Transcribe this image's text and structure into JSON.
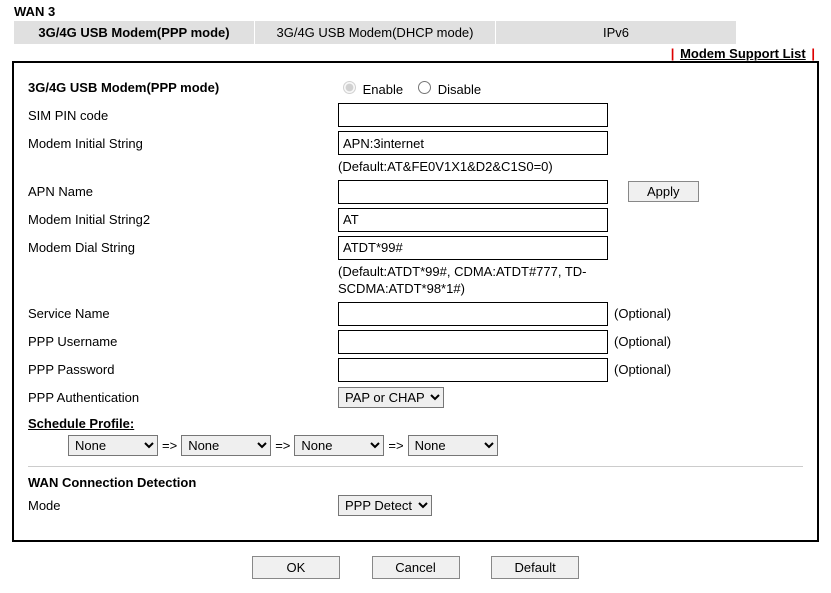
{
  "header": "WAN 3",
  "tabs": {
    "t0": "3G/4G USB Modem(PPP mode)",
    "t1": "3G/4G USB Modem(DHCP mode)",
    "t2": "IPv6"
  },
  "support_link": "Modem Support List",
  "section1": {
    "title": "3G/4G USB Modem(PPP mode)",
    "enable": "Enable",
    "disable": "Disable",
    "sim_pin_label": "SIM PIN code",
    "sim_pin_value": "",
    "mis_label": "Modem Initial String",
    "mis_value": "APN:3internet",
    "mis_hint": "(Default:AT&FE0V1X1&D2&C1S0=0)",
    "apn_label": "APN Name",
    "apn_value": "",
    "apply": "Apply",
    "mis2_label": "Modem Initial String2",
    "mis2_value": "AT",
    "dial_label": "Modem Dial String",
    "dial_value": "ATDT*99#",
    "dial_hint": "(Default:ATDT*99#, CDMA:ATDT#777, TD-SCDMA:ATDT*98*1#)",
    "service_label": "Service Name",
    "service_value": "",
    "ppp_user_label": "PPP Username",
    "ppp_user_value": "",
    "ppp_pass_label": "PPP Password",
    "ppp_pass_value": "",
    "optional": "(Optional)",
    "ppp_auth_label": "PPP Authentication",
    "ppp_auth_value": "PAP or CHAP",
    "schedule_label": "Schedule Profile",
    "arrow": "=>",
    "none": "None"
  },
  "section2": {
    "title": "WAN Connection Detection",
    "mode_label": "Mode",
    "mode_value": "PPP Detect"
  },
  "buttons": {
    "ok": "OK",
    "cancel": "Cancel",
    "default": "Default"
  }
}
